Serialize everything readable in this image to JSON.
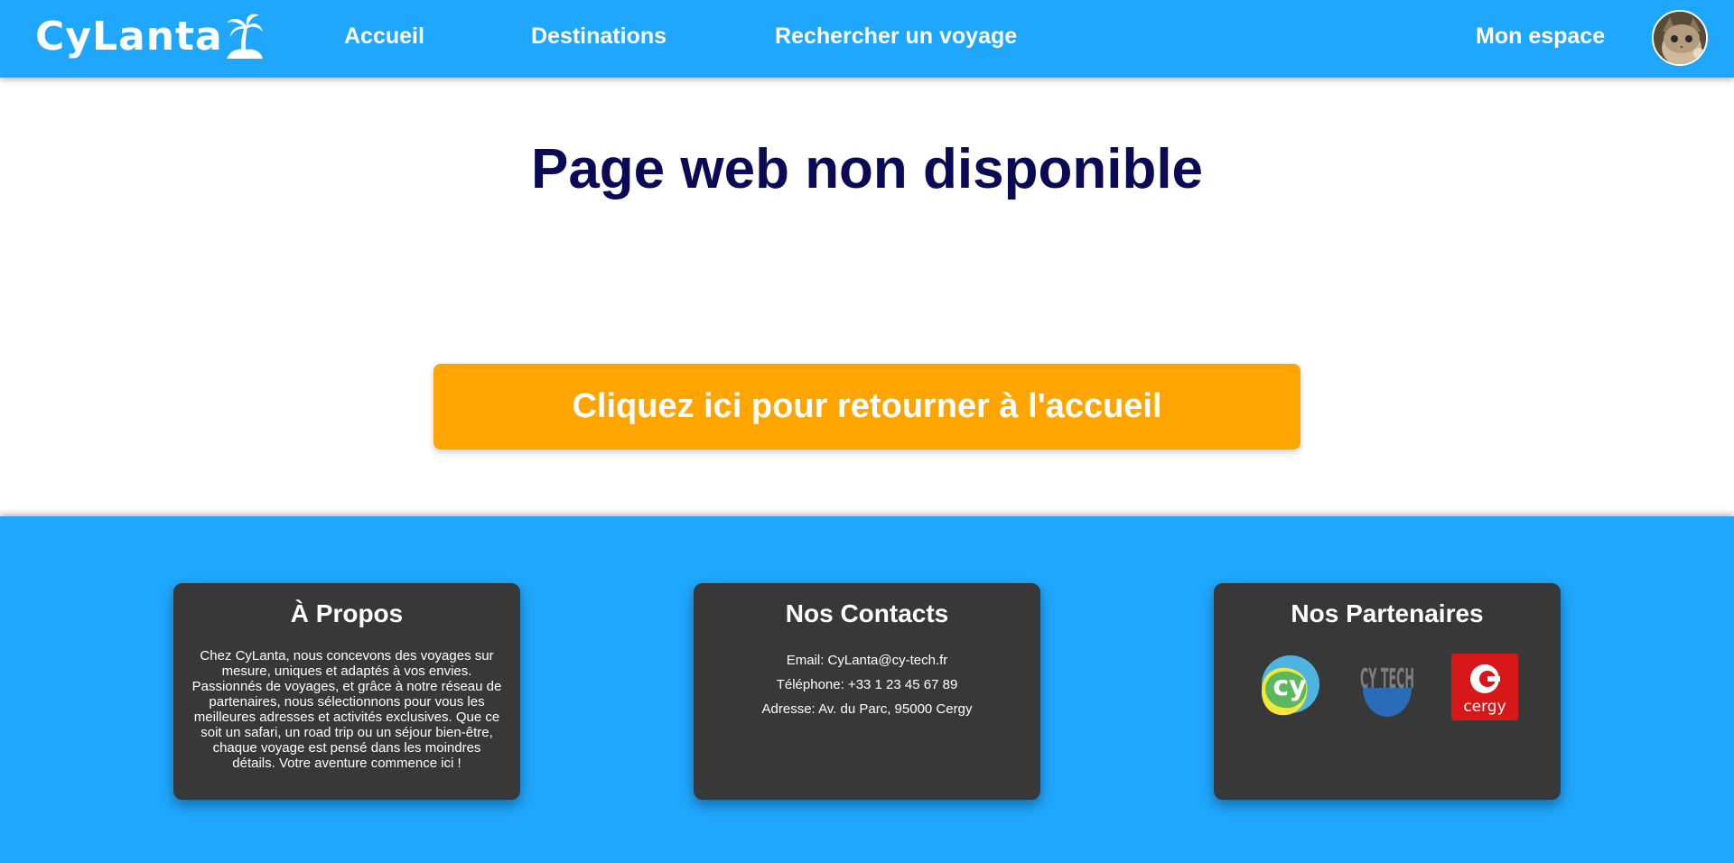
{
  "header": {
    "brand": "CyLanta",
    "nav": [
      {
        "label": "Accueil"
      },
      {
        "label": "Destinations"
      },
      {
        "label": "Rechercher un voyage"
      }
    ],
    "account_label": "Mon espace"
  },
  "main": {
    "title": "Page web non disponible",
    "home_button": "Cliquez ici pour retourner à l'accueil"
  },
  "footer": {
    "about": {
      "title": "À Propos",
      "text": "Chez CyLanta, nous concevons des voyages sur mesure, uniques et adaptés à vos envies. Passionnés de voyages, et grâce à notre réseau de partenaires, nous sélectionnons pour vous les meilleures adresses et activités exclusives. Que ce soit un safari, un road trip ou un séjour bien-être, chaque voyage est pensé dans les moindres détails. Votre aventure commence ici !"
    },
    "contacts": {
      "title": "Nos Contacts",
      "email": "Email: CyLanta@cy-tech.fr",
      "phone": "Téléphone: +33 1 23 45 67 89",
      "address": "Adresse: Av. du Parc, 95000 Cergy"
    },
    "partners": {
      "title": "Nos Partenaires",
      "logos": [
        {
          "icon": "cy-logo",
          "text": "cy"
        },
        {
          "icon": "cy-tech-logo",
          "text": "CY TECH"
        },
        {
          "icon": "cergy-logo",
          "text": "cergy"
        }
      ]
    }
  },
  "colors": {
    "primary": "#1fa7fd",
    "accent": "#ffa502",
    "title": "#0b0b55",
    "card": "#383838"
  }
}
